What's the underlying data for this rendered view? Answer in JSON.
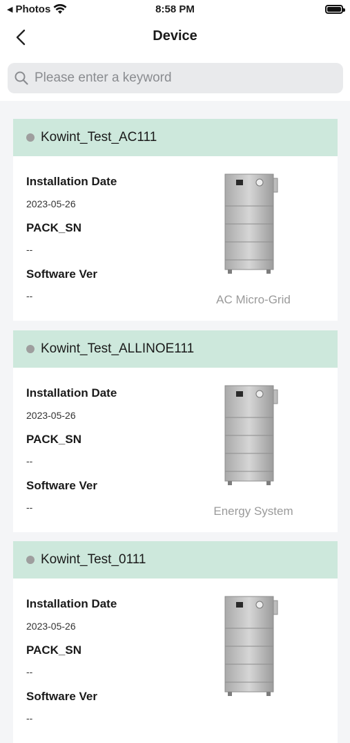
{
  "status_bar": {
    "carrier": "Photos",
    "time": "8:58 PM"
  },
  "nav": {
    "title": "Device"
  },
  "search": {
    "placeholder": "Please enter a keyword"
  },
  "labels": {
    "install_date": "Installation Date",
    "pack_sn": "PACK_SN",
    "software_ver": "Software Ver"
  },
  "devices": [
    {
      "name": "Kowint_Test_AC111",
      "install_date": "2023-05-26",
      "pack_sn": "--",
      "software_ver": "--",
      "type": "AC Micro-Grid",
      "status_color": "#9e9e9e"
    },
    {
      "name": "Kowint_Test_ALLINOE111",
      "install_date": "2023-05-26",
      "pack_sn": "--",
      "software_ver": "--",
      "type": "Energy System",
      "status_color": "#9e9e9e"
    },
    {
      "name": "Kowint_Test_0111",
      "install_date": "2023-05-26",
      "pack_sn": "--",
      "software_ver": "--",
      "type": "",
      "status_color": "#9e9e9e"
    }
  ],
  "colors": {
    "card_header": "#cde8dc",
    "background": "#f4f5f7"
  }
}
